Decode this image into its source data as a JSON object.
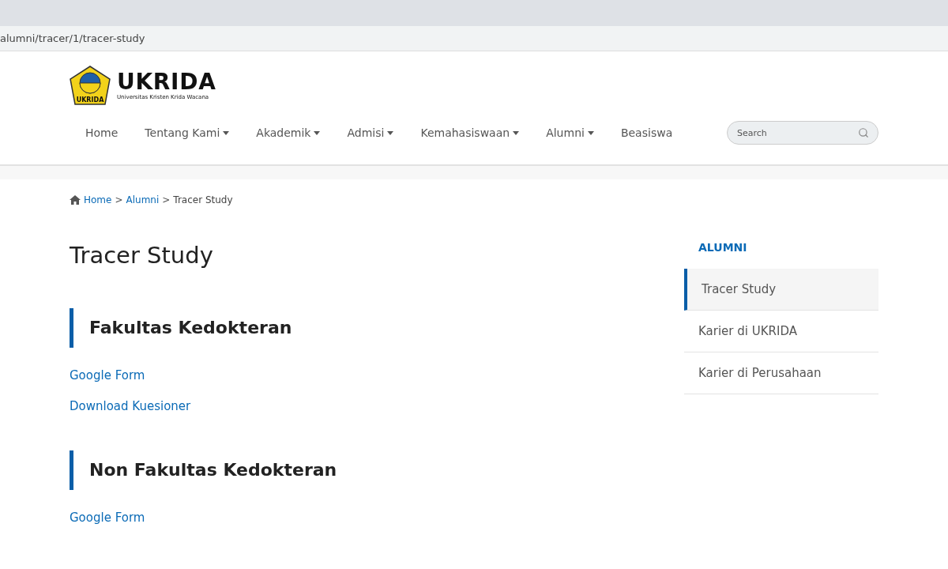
{
  "address_bar": {
    "url": "alumni/tracer/1/tracer-study"
  },
  "logo": {
    "name": "UKRIDA",
    "subtitle": "Universitas Kristen Krida Wacana",
    "seal_text": "UKRIDA"
  },
  "nav": [
    {
      "label": "Home",
      "has_menu": false
    },
    {
      "label": "Tentang Kami",
      "has_menu": true
    },
    {
      "label": "Akademik",
      "has_menu": true
    },
    {
      "label": "Admisi",
      "has_menu": true
    },
    {
      "label": "Kemahasiswaan",
      "has_menu": true
    },
    {
      "label": "Alumni",
      "has_menu": true
    },
    {
      "label": "Beasiswa",
      "has_menu": false
    }
  ],
  "search": {
    "placeholder": "Search"
  },
  "breadcrumb": [
    {
      "label": "Home",
      "link": true
    },
    {
      "label": "Alumni",
      "link": true
    },
    {
      "label": "Tracer Study",
      "link": false
    }
  ],
  "breadcrumb_separator": ">",
  "page_title": "Tracer Study",
  "sections": [
    {
      "heading": "Fakultas Kedokteran",
      "links": [
        "Google Form",
        "Download Kuesioner"
      ]
    },
    {
      "heading": "Non Fakultas Kedokteran",
      "links": [
        "Google Form"
      ]
    }
  ],
  "sidebar": {
    "title": "ALUMNI",
    "items": [
      {
        "label": "Tracer Study",
        "selected": true
      },
      {
        "label": "Karier di UKRIDA",
        "selected": false
      },
      {
        "label": "Karier di Perusahaan",
        "selected": false
      }
    ]
  }
}
